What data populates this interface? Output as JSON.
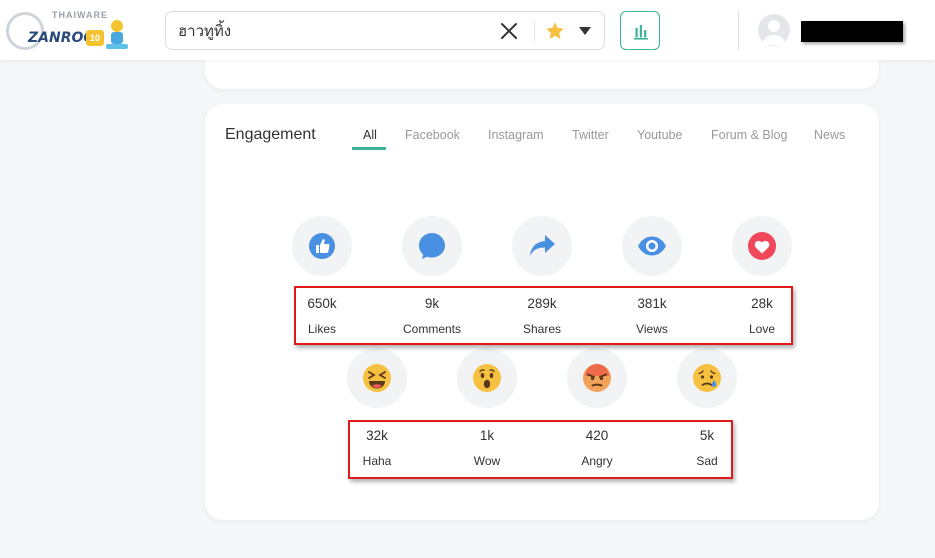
{
  "header": {
    "logo_top_text": "THAIWARE",
    "logo_word": "ZANROO",
    "search": {
      "value": "ฮาวทูทิ้ง",
      "placeholder": ""
    }
  },
  "engagement": {
    "title": "Engagement",
    "tabs": [
      {
        "label": "All",
        "active": true
      },
      {
        "label": "Facebook",
        "active": false
      },
      {
        "label": "Instagram",
        "active": false
      },
      {
        "label": "Twitter",
        "active": false
      },
      {
        "label": "Youtube",
        "active": false
      },
      {
        "label": "Forum & Blog",
        "active": false
      },
      {
        "label": "News",
        "active": false
      }
    ],
    "metrics_row1": [
      {
        "icon": "like-icon",
        "value": "650k",
        "label": "Likes"
      },
      {
        "icon": "comment-icon",
        "value": "9k",
        "label": "Comments"
      },
      {
        "icon": "share-icon",
        "value": "289k",
        "label": "Shares"
      },
      {
        "icon": "eye-icon",
        "value": "381k",
        "label": "Views"
      },
      {
        "icon": "heart-icon",
        "value": "28k",
        "label": "Love"
      }
    ],
    "metrics_row2": [
      {
        "icon": "haha-emoji-icon",
        "value": "32k",
        "label": "Haha"
      },
      {
        "icon": "wow-emoji-icon",
        "value": "1k",
        "label": "Wow"
      },
      {
        "icon": "angry-emoji-icon",
        "value": "420",
        "label": "Angry"
      },
      {
        "icon": "sad-emoji-icon",
        "value": "5k",
        "label": "Sad"
      }
    ]
  },
  "colors": {
    "accent": "#3cb39a",
    "brand_blue": "#4a90e2",
    "love_red": "#f0475a",
    "emoji_yellow": "#f6c141",
    "highlight_red": "#e01a1a"
  }
}
